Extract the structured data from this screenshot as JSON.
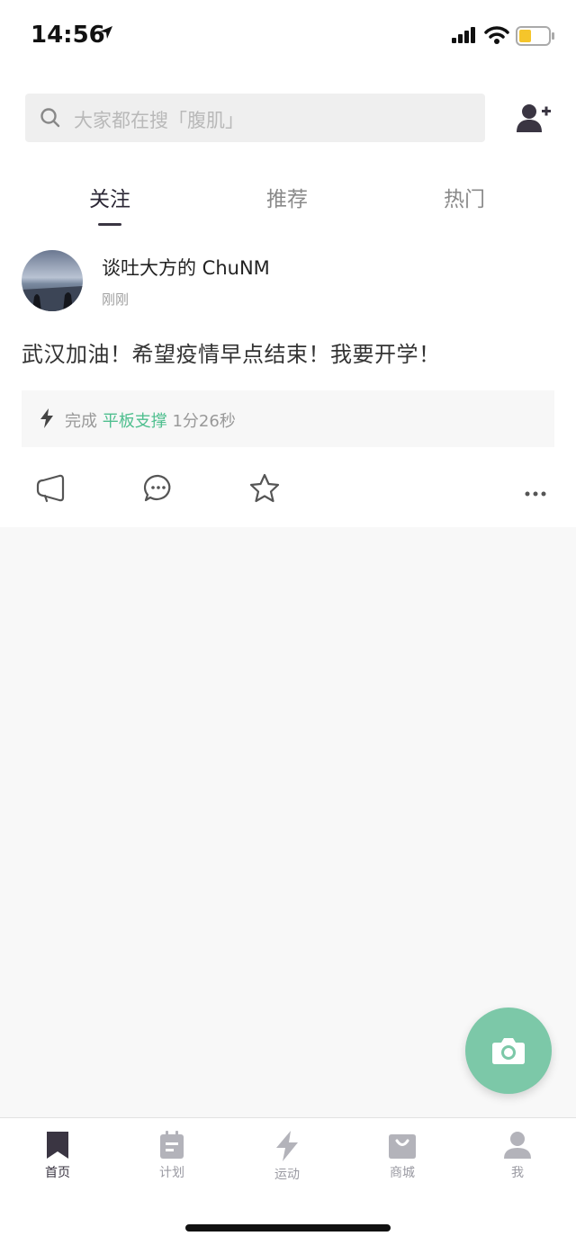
{
  "status": {
    "time": "14:56"
  },
  "search": {
    "placeholder": "大家都在搜「腹肌」"
  },
  "tabs": [
    {
      "label": "关注",
      "active": true
    },
    {
      "label": "推荐",
      "active": false
    },
    {
      "label": "热门",
      "active": false
    }
  ],
  "post": {
    "username": "谈吐大方的 ChuNM",
    "time": "刚刚",
    "text": "武汉加油！希望疫情早点结束！我要开学！",
    "workout": {
      "prefix": "完成",
      "name": "平板支撑",
      "duration": "1分26秒"
    }
  },
  "tabbar": [
    {
      "label": "首页",
      "icon": "bookmark-icon",
      "active": true
    },
    {
      "label": "计划",
      "icon": "plan-icon",
      "active": false
    },
    {
      "label": "运动",
      "icon": "bolt-icon",
      "active": false
    },
    {
      "label": "商城",
      "icon": "shop-bag-icon",
      "active": false
    },
    {
      "label": "我",
      "icon": "person-icon",
      "active": false
    }
  ],
  "colors": {
    "accent_green": "#4fbf8f",
    "fab": "#7cc8a8",
    "active_dark": "#3a3542"
  }
}
